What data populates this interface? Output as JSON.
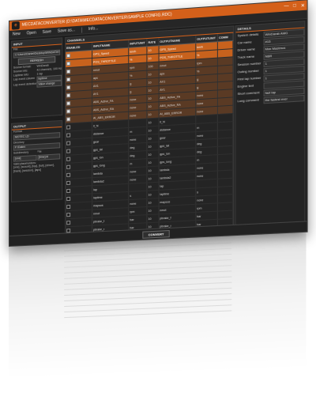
{
  "window": {
    "title": "MECDATACONVERTER (D:\\DATA\\MECDATACONVERTER\\SAMPLE CONFIG.RDC)",
    "logo_text": "e",
    "minimize": "—",
    "maximize": "□",
    "close": "✕"
  },
  "menu": [
    "New",
    "Open",
    "Save",
    "Save as...",
    "Info..."
  ],
  "input": {
    "header": "INPUT",
    "file_label": "File",
    "file_value": "C:\\Users\\Daniel\\Desktop\\WINDATA\\TestFile.ld",
    "button": "REFRESH",
    "info": [
      {
        "k": "Source format:",
        "v": "WinDarab"
      },
      {
        "k": "Source info:",
        "v": "42 channels, 100 Hz"
      },
      {
        "k": "Laptime info:",
        "v": "1 lap"
      }
    ],
    "lap_event_label": "Lap event column",
    "lap_event_value": "laptime",
    "lap_detection_label": "Lap event detection",
    "lap_detection_value": "Value change"
  },
  "output": {
    "header": "OUTPUT",
    "format_label": "Format",
    "format_value": "MOTEC LD",
    "directory_label": "Directory",
    "directory_value": "F:\\Daten",
    "subdirectory_label": "Subdirectory",
    "file_label": "File",
    "subdirectory_value": "[one]",
    "file_value": "[time].ld",
    "placeholders_label": "Valid placeholders:",
    "placeholders": "[one], [scount], [top], [full], [driver], [track], [session], [laps]"
  },
  "channels": {
    "header": "CHANNELS",
    "columns": [
      "ENABLED",
      "INPUTNAME",
      "INPUTUNIT",
      "RATE",
      "OUTPUTNAME",
      "OUTPUTUNIT",
      "COMM"
    ],
    "rows": [
      {
        "on": true,
        "in": "GPS_Speed",
        "iu": "km/h",
        "rate": "10",
        "out": "GPS_Speed",
        "ou": "km/h",
        "style": "sel"
      },
      {
        "on": true,
        "in": "POS_THROTTLE",
        "iu": "%",
        "rate": "10",
        "out": "POS_THROTTLE",
        "ou": "%",
        "style": "sel"
      },
      {
        "on": true,
        "in": "nmot",
        "iu": "rpm",
        "rate": "100",
        "out": "nmot",
        "ou": "rpm",
        "style": "alt"
      },
      {
        "on": true,
        "in": "aps",
        "iu": "%",
        "rate": "10",
        "out": "aps",
        "ou": "%",
        "style": "alt"
      },
      {
        "on": true,
        "in": "AX1",
        "iu": "g",
        "rate": "10",
        "out": "AX1",
        "ou": "g",
        "style": "alt"
      },
      {
        "on": true,
        "in": "AY1",
        "iu": "g",
        "rate": "10",
        "out": "AY1",
        "ou": "g",
        "style": "alt"
      },
      {
        "on": true,
        "in": "ABS_Active_FA",
        "iu": "none",
        "rate": "10",
        "out": "ABS_Active_FA",
        "ou": "none",
        "style": "alt"
      },
      {
        "on": true,
        "in": "ABS_Active_RA",
        "iu": "none",
        "rate": "10",
        "out": "ABS_Active_RA",
        "ou": "none",
        "style": "alt"
      },
      {
        "on": true,
        "in": "AI_ABS_ERROR",
        "iu": "none",
        "rate": "10",
        "out": "AI_ABS_ERROR",
        "ou": "none",
        "style": "alt"
      },
      {
        "on": false,
        "in": "ll_hi",
        "iu": "",
        "rate": "10",
        "out": "ll_hi",
        "ou": "",
        "style": "norm"
      },
      {
        "on": false,
        "in": "distance",
        "iu": "m",
        "rate": "10",
        "out": "distance",
        "ou": "m",
        "style": "norm"
      },
      {
        "on": false,
        "in": "gear",
        "iu": "none",
        "rate": "10",
        "out": "gear",
        "ou": "none",
        "style": "norm"
      },
      {
        "on": false,
        "in": "gps_lat",
        "iu": "deg",
        "rate": "10",
        "out": "gps_lat",
        "ou": "deg",
        "style": "norm"
      },
      {
        "on": false,
        "in": "gps_lon",
        "iu": "deg",
        "rate": "10",
        "out": "gps_lon",
        "ou": "deg",
        "style": "norm"
      },
      {
        "on": false,
        "in": "gps_long",
        "iu": "m",
        "rate": "10",
        "out": "gps_long",
        "ou": "m",
        "style": "norm"
      },
      {
        "on": false,
        "in": "lambda",
        "iu": "none",
        "rate": "10",
        "out": "lambda",
        "ou": "none",
        "style": "norm"
      },
      {
        "on": false,
        "in": "lambda2",
        "iu": "none",
        "rate": "10",
        "out": "lambda2",
        "ou": "none",
        "style": "norm"
      },
      {
        "on": false,
        "in": "lap",
        "iu": "",
        "rate": "10",
        "out": "lap",
        "ou": "",
        "style": "norm"
      },
      {
        "on": false,
        "in": "laptime",
        "iu": "s",
        "rate": "10",
        "out": "laptime",
        "ou": "s",
        "style": "norm"
      },
      {
        "on": false,
        "in": "mapsos",
        "iu": "none",
        "rate": "10",
        "out": "mapsos",
        "ou": "none",
        "style": "norm"
      },
      {
        "on": false,
        "in": "nmot",
        "iu": "rpm",
        "rate": "10",
        "out": "nmot",
        "ou": "rpm",
        "style": "norm"
      },
      {
        "on": false,
        "in": "pbrake_f",
        "iu": "bar",
        "rate": "10",
        "out": "pbrake_f",
        "ou": "bar",
        "style": "norm"
      },
      {
        "on": false,
        "in": "pbrake_r",
        "iu": "bar",
        "rate": "10",
        "out": "pbrake_r",
        "ou": "bar",
        "style": "norm"
      }
    ]
  },
  "details": {
    "header": "DETAILS",
    "fields": [
      {
        "k": "System details",
        "v": "WinDarab AMG"
      },
      {
        "k": "Car name",
        "v": "#15"
      },
      {
        "k": "Driver name",
        "v": "Max Mastmus"
      },
      {
        "k": "Track name",
        "v": "NBR"
      },
      {
        "k": "Session number",
        "v": "1"
      },
      {
        "k": "Outing number",
        "v": "1"
      },
      {
        "k": "First lap number",
        "v": "1"
      },
      {
        "k": "Engine text",
        "v": ""
      },
      {
        "k": "Short comment",
        "v": "fast lap"
      },
      {
        "k": "Long comment",
        "v": "the fastest ever"
      }
    ]
  },
  "footer": {
    "convert_label": "CONVERT"
  },
  "colors": {
    "accent": "#d4601a",
    "selected_row": "#c8621d",
    "enabled_row": "#5a3a24",
    "background": "#1d1d1d"
  }
}
